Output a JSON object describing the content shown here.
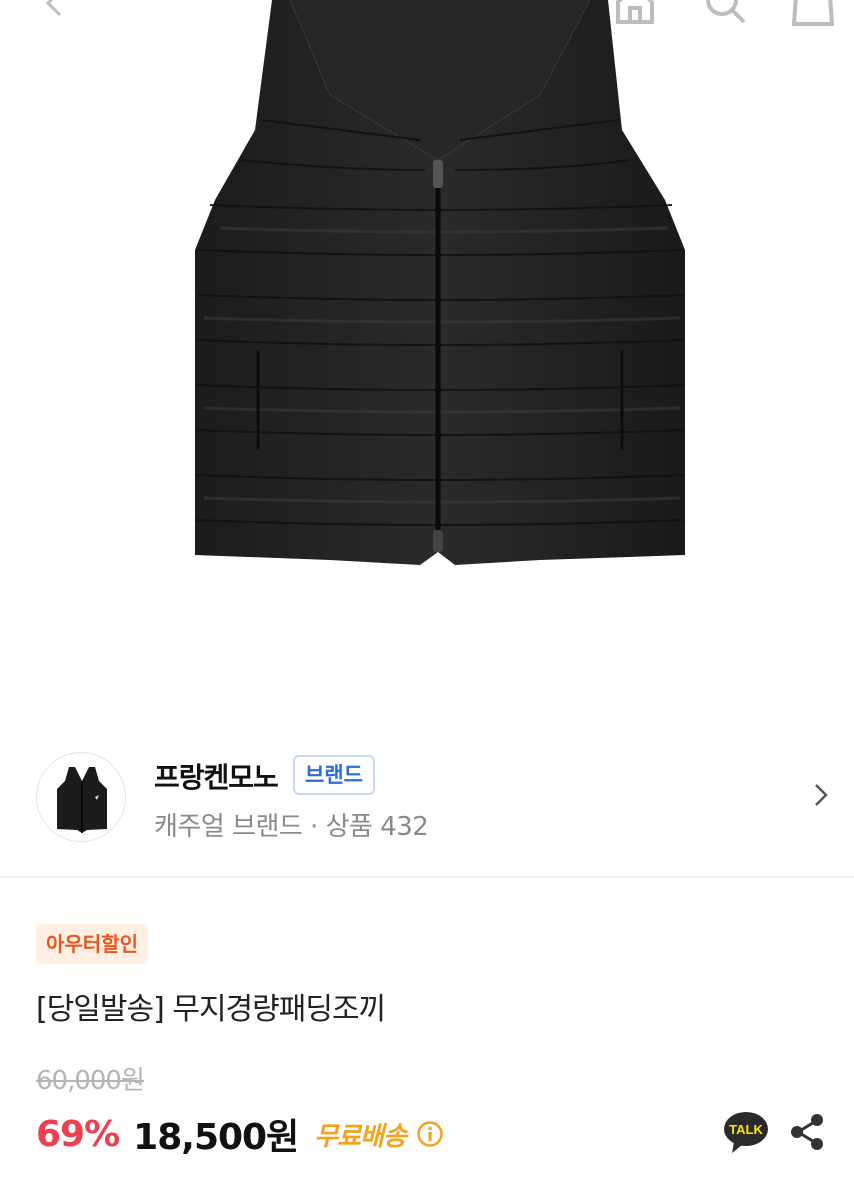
{
  "header": {
    "back_icon": "chevron-left-icon",
    "home_icon": "home-icon",
    "search_icon": "search-icon",
    "cart_icon": "cart-icon"
  },
  "product_image": {
    "alt": "black quilted padded vest"
  },
  "brand": {
    "name": "프랑켄모노",
    "badge": "브랜드",
    "subtitle": "캐주얼 브랜드 · 상품 432"
  },
  "product": {
    "tag": "아우터할인",
    "title": "[당일발송] 무지경량패딩조끼",
    "original_price": "60,000원",
    "discount": "69%",
    "price": "18,500원",
    "shipping": "무료배송"
  },
  "actions": {
    "talk_label": "TALK",
    "share_icon": "share-icon"
  },
  "colors": {
    "discount": "#ee3f50",
    "shipping": "#f5a21d",
    "badge_text": "#2f6bd6",
    "tag_text": "#e8571e",
    "tag_bg": "#fff0e3",
    "talk_bg": "#2a2a2a",
    "talk_accent": "#fee500"
  }
}
